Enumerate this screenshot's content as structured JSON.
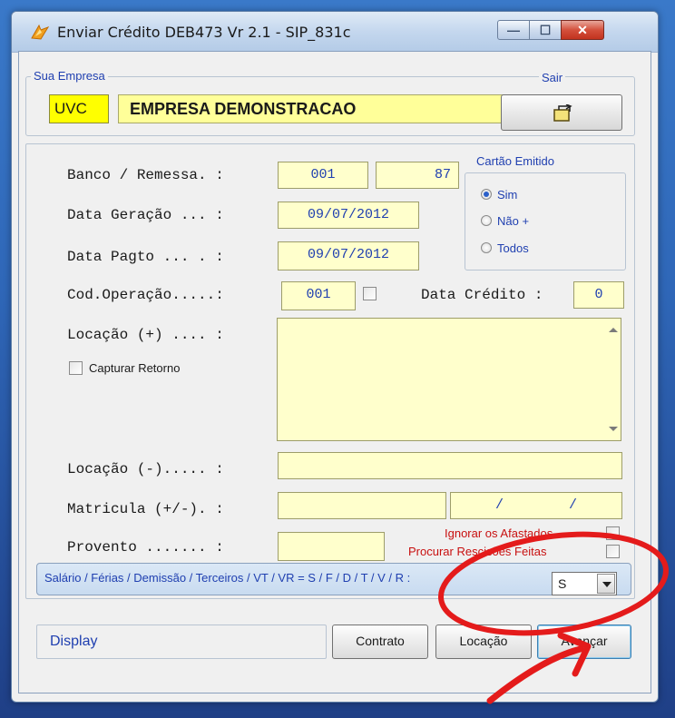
{
  "window": {
    "title": "Enviar Crédito DEB473 Vr 2.1 - SIP_831c",
    "controls": {
      "minimize": "—",
      "maximize": "☐",
      "close": "✕"
    }
  },
  "company": {
    "group_label": "Sua Empresa",
    "code": "UVC",
    "name": "EMPRESA DEMONSTRACAO",
    "exit_label": "Sair"
  },
  "form": {
    "banco_label": "Banco / Remessa. :",
    "banco": "001",
    "remessa": "87",
    "data_geracao_label": "Data Geração ... :",
    "data_geracao": "09/07/2012",
    "data_pagto_label": "Data Pagto ... . :",
    "data_pagto": "09/07/2012",
    "cod_operacao_label": "Cod.Operação.....:",
    "cod_operacao": "001",
    "data_credito_label": "Data Crédito :",
    "data_credito": "0",
    "locacao_mais_label": "Locação (+) .... :",
    "capturar_retorno_label": "Capturar Retorno",
    "locacao_menos_label": "Locação (-)..... :",
    "matricula_label": "Matricula (+/-). :",
    "matricula_date": "/        /",
    "provento_label": "Provento ....... :",
    "ignorar_label": "Ignorar os Afastados",
    "procurar_label": "Procurar Rescisões Feitas"
  },
  "cartao": {
    "group_label": "Cartão Emitido",
    "options": [
      "Sim",
      "Não +",
      "Todos"
    ],
    "selected": "Sim"
  },
  "tipo": {
    "label": "Salário / Férias / Demissão / Terceiros / VT / VR = S / F / D / T / V / R :",
    "value": "S"
  },
  "footer": {
    "display_label": "Display",
    "contrato_label": "Contrato",
    "locacao_label": "Locação",
    "avancar_label": "Avançar"
  },
  "colors": {
    "accent": "#1f3fb0",
    "field_bg": "#ffffcc",
    "annotation": "#e41b1b"
  }
}
